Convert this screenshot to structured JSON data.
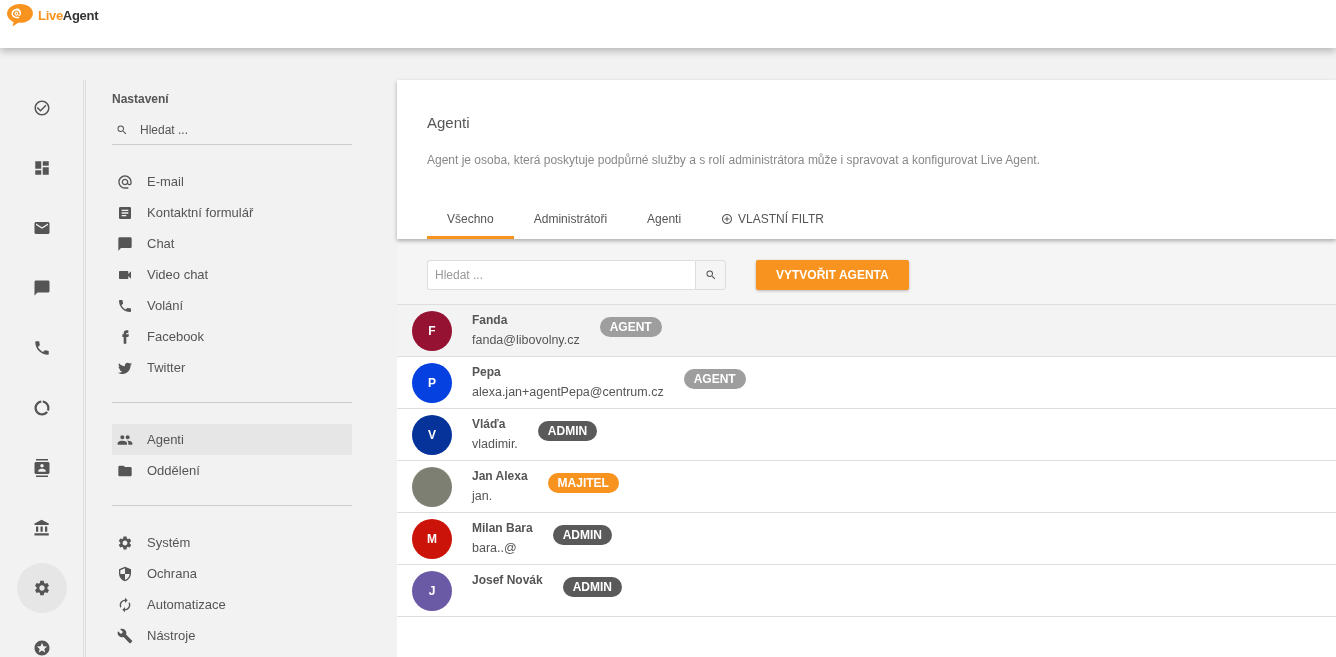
{
  "logo": {
    "part1": "Live",
    "part2": "Agent"
  },
  "rail": [
    {
      "selected": false
    },
    {
      "selected": false
    },
    {
      "selected": false
    },
    {
      "selected": false
    },
    {
      "selected": false
    },
    {
      "selected": false
    },
    {
      "selected": false
    },
    {
      "selected": false
    },
    {
      "selected": true
    },
    {
      "selected": false
    }
  ],
  "sidebar": {
    "title": "Nastavení",
    "search": {
      "placeholder": "Hledat ..."
    },
    "groups": [
      {
        "items": [
          {
            "label": "E-mail",
            "selected": false
          },
          {
            "label": "Kontaktní formulář",
            "selected": false
          },
          {
            "label": "Chat",
            "selected": false
          },
          {
            "label": "Video chat",
            "selected": false
          },
          {
            "label": "Volání",
            "selected": false
          },
          {
            "label": "Facebook",
            "selected": false
          },
          {
            "label": "Twitter",
            "selected": false
          }
        ]
      },
      {
        "items": [
          {
            "label": "Agenti",
            "selected": true
          },
          {
            "label": "Oddělení",
            "selected": false
          }
        ]
      },
      {
        "items": [
          {
            "label": "Systém",
            "selected": false
          },
          {
            "label": "Ochrana",
            "selected": false
          },
          {
            "label": "Automatizace",
            "selected": false
          },
          {
            "label": "Nástroje",
            "selected": false
          }
        ]
      }
    ]
  },
  "page": {
    "title": "Agenti",
    "description": "Agent je osoba, která poskytuje podpůrné služby a s rolí administrátora může i spravovat a konfigurovat Live Agent."
  },
  "tabs": [
    {
      "label": "Všechno",
      "selected": true,
      "kind": "text"
    },
    {
      "label": "Administrátoři",
      "selected": false,
      "kind": "text"
    },
    {
      "label": "Agenti",
      "selected": false,
      "kind": "text"
    },
    {
      "label": "VLASTNÍ FILTR",
      "selected": false,
      "kind": "filter"
    }
  ],
  "search": {
    "placeholder": "Hledat ..."
  },
  "create_button": "VYTVOŘIT AGENTA",
  "agents": [
    {
      "avatar": {
        "kind": "initial",
        "initial": "F",
        "color": "#951233"
      },
      "name": "Fanda",
      "email": "fanda@libovolny.cz",
      "role": {
        "kind": "agent",
        "label": "AGENT"
      },
      "highlighted": true
    },
    {
      "avatar": {
        "kind": "initial",
        "initial": "P",
        "color": "#0540e0"
      },
      "name": "Pepa",
      "email": "alexa.jan+agentPepa@centrum.cz",
      "role": {
        "kind": "agent",
        "label": "AGENT"
      },
      "highlighted": false
    },
    {
      "avatar": {
        "kind": "initial",
        "initial": "V",
        "color": "#05339a"
      },
      "name": "Vláďa",
      "email": "vladimir.",
      "role": {
        "kind": "admin",
        "label": "ADMIN"
      },
      "highlighted": false
    },
    {
      "avatar": {
        "kind": "photo"
      },
      "name": "Jan Alexa",
      "email": "jan.",
      "role": {
        "kind": "owner",
        "label": "MAJITEL"
      },
      "highlighted": false
    },
    {
      "avatar": {
        "kind": "initial",
        "initial": "M",
        "color": "#cc1309"
      },
      "name": "Milan Bara",
      "email": "bara..@",
      "role": {
        "kind": "admin",
        "label": "ADMIN"
      },
      "highlighted": false
    },
    {
      "avatar": {
        "kind": "initial",
        "initial": "J",
        "color": "#6a5aa6"
      },
      "name": "Josef Novák",
      "role": {
        "kind": "admin",
        "label": "ADMIN"
      },
      "highlighted": false
    }
  ]
}
